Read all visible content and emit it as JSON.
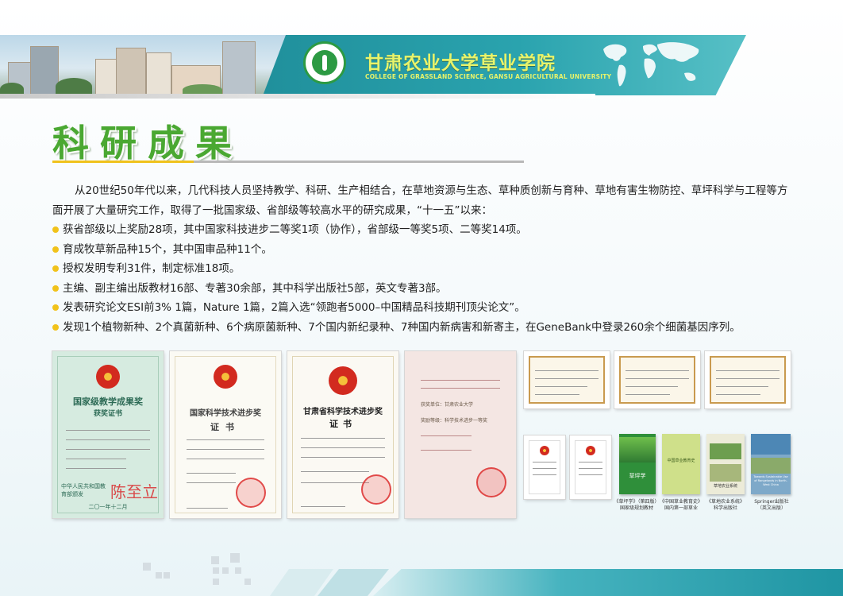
{
  "header": {
    "college_name_cn": "甘肃农业大学草业学院",
    "college_name_en": "COLLEGE OF GRASSLAND SCIENCE, GANSU AGRICULTURAL UNIVERSITY"
  },
  "page_title": "科研成果",
  "intro": "从20世纪50年代以来，几代科技人员坚持教学、科研、生产相结合，在草地资源与生态、草种质创新与育种、草地有害生物防控、草坪科学与工程等方面开展了大量研究工作，取得了一批国家级、省部级等较高水平的研究成果，“十一五”以来：",
  "achievements": [
    "获省部级以上奖励28项，其中国家科技进步二等奖1项（协作），省部级一等奖5项、二等奖14项。",
    "育成牧草新品种15个，其中国审品种11个。",
    "授权发明专利31件，制定标准18项。",
    "主编、副主编出版教材16部、专著30余部，其中科学出版社5部，英文专著3部。",
    "发表研究论文ESI前3% 1篇，Nature 1篇，2篇入选“领跑者5000–中国精品科技期刊顶尖论文”。",
    "发现1个植物新种、2个真菌新种、6个病原菌新种、7个国内新纪录种、7种国内新病害和新寄主，在GeneBank中登录260余个细菌基因序列。"
  ],
  "certificates": {
    "c1": {
      "title": "国家级教学成果奖",
      "subtitle": "获奖证书",
      "issuer": "中华人民共和国教育部颁发",
      "date": "二〇一年十二月",
      "signature": "陈至立"
    },
    "c2": {
      "title": "国家科学技术进步奖",
      "subtitle": "证书"
    },
    "c3": {
      "title": "甘肃省科学技术进步奖",
      "subtitle": "证书"
    },
    "c4": {
      "line1": "获奖单位：甘肃农业大学",
      "line2": "奖励等级：科学技术进步一等奖"
    }
  },
  "books": [
    {
      "cover_title": "草坪学",
      "caption_1": "《草坪学》（第四版）",
      "caption_2": "国家级规划教材",
      "color": "#2f8f3a"
    },
    {
      "cover_title": "中国草业教育史",
      "caption_1": "《中国草业教育史》",
      "caption_2": "国内第一部草业",
      "color": "#cfe08a"
    },
    {
      "cover_title": "草地农业系统",
      "caption_1": "《草地农业系统》",
      "caption_2": "科学出版社",
      "color": "#ecebd8"
    },
    {
      "cover_title": "Towards Sustainable Use of Rangelands in North-West China",
      "caption_1": "Springer出版社",
      "caption_2": "（英文出版）",
      "color": "#7ea9c9"
    }
  ],
  "colors": {
    "title_green": "#4aa832",
    "accent_yellow": "#f1c21a",
    "banner_teal": "#2aa3ae"
  }
}
